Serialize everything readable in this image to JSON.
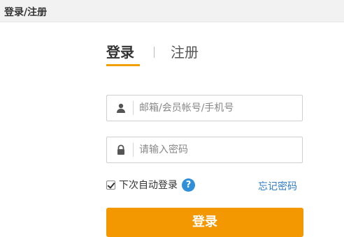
{
  "window": {
    "title": "登录/注册"
  },
  "tabs": [
    {
      "label": "登录",
      "active": true
    },
    {
      "label": "注册",
      "active": false
    }
  ],
  "form": {
    "username": {
      "placeholder": "邮箱/会员帐号/手机号",
      "value": "",
      "icon": "user-icon"
    },
    "password": {
      "placeholder": "请输入密码",
      "value": "",
      "icon": "lock-icon"
    },
    "remember": {
      "label": "下次自动登录",
      "checked": true,
      "help_icon": "?"
    },
    "forgot_label": "忘记密码",
    "submit_label": "登录"
  },
  "colors": {
    "accent": "#f39800",
    "link": "#2f7bc4",
    "help_icon": "#2f8fd8"
  }
}
